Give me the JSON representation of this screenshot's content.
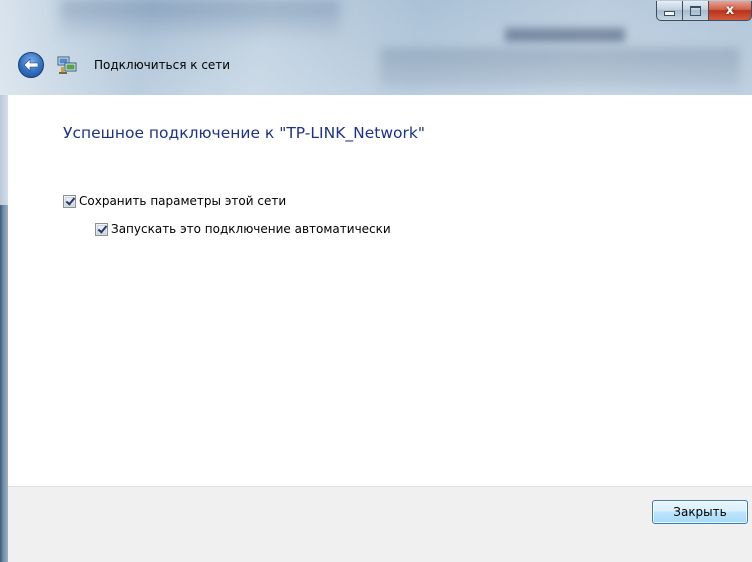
{
  "window": {
    "title": "Подключиться к сети",
    "caption": {
      "minimize": "",
      "maximize": "",
      "close": "x"
    }
  },
  "icons": {
    "back": "back-arrow-icon",
    "network": "network-connection-icon"
  },
  "colors": {
    "heading": "#1e3287",
    "close_button_red": "#c23b1f",
    "primary_button_border": "#3c7fb1",
    "footer_bg": "#f0f0f0"
  },
  "content": {
    "heading": "Успешное подключение к \"TP-LINK_Network\"",
    "options": [
      {
        "label": "Сохранить параметры этой сети",
        "checked": true
      },
      {
        "label": "Запускать это подключение автоматически",
        "checked": true
      }
    ]
  },
  "footer": {
    "close_label": "Закрыть"
  }
}
